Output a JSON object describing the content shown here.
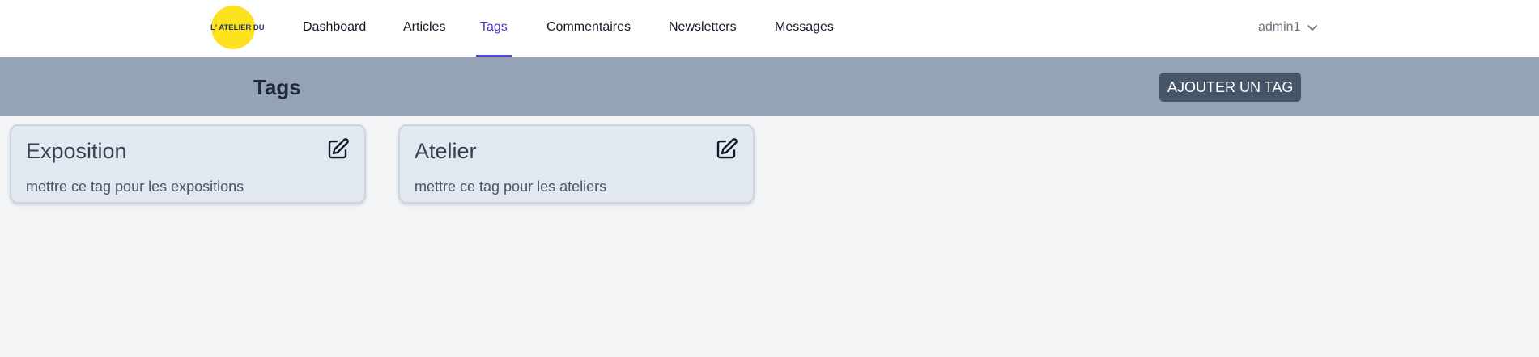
{
  "nav": {
    "logo_text": "L' ATELIER DU SUD",
    "links": [
      {
        "label": "Dashboard",
        "active": false
      },
      {
        "label": "Articles",
        "active": false
      },
      {
        "label": "Tags",
        "active": true
      },
      {
        "label": "Commentaires",
        "active": false
      },
      {
        "label": "Newsletters",
        "active": false
      },
      {
        "label": "Messages",
        "active": false
      }
    ],
    "user": {
      "name": "admin1",
      "icon": "chevron-down-icon"
    }
  },
  "header": {
    "title": "Tags",
    "add_button_label": "AJOUTER UN TAG"
  },
  "tags": [
    {
      "title": "Exposition",
      "description": "mettre ce tag pour les expositions",
      "icon": "edit-icon"
    },
    {
      "title": "Atelier",
      "description": "mettre ce tag pour les ateliers",
      "icon": "edit-icon"
    }
  ],
  "colors": {
    "active_link": "#4338ca",
    "header_band": "#94a3b8",
    "button_bg": "#475569",
    "card_bg": "#e2e8f0",
    "logo_sun": "#fde21f"
  }
}
